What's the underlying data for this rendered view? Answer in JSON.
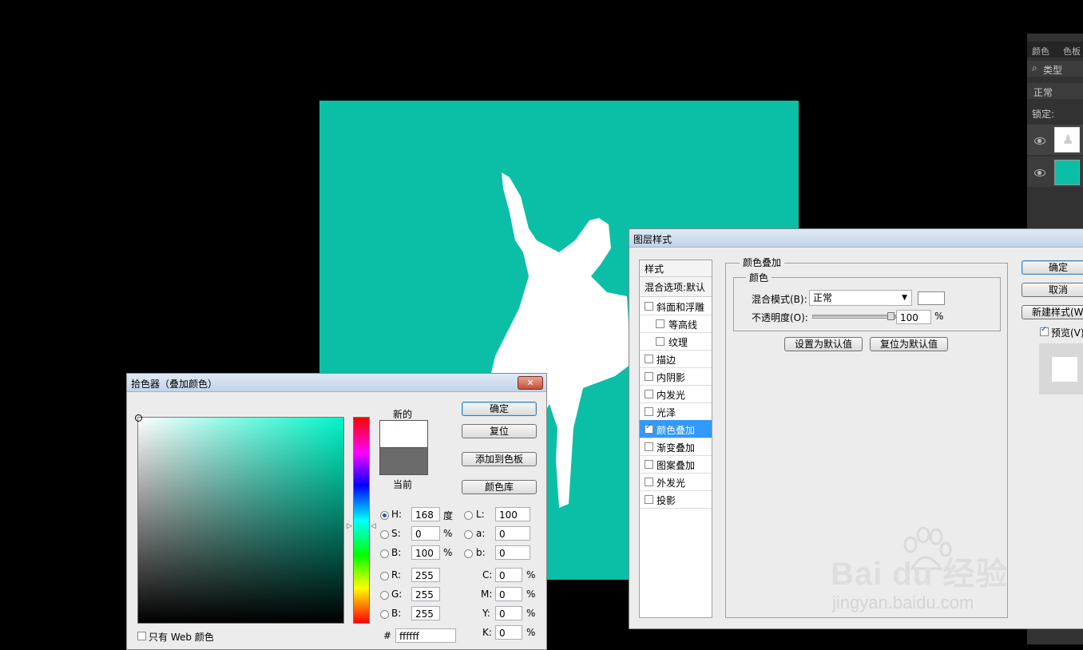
{
  "layers_panel": {
    "tabs": [
      "颜色",
      "色板"
    ],
    "filter_label": "类型",
    "blend_mode": "正常",
    "lock_label": "锁定:"
  },
  "layer_style": {
    "title": "图层样式",
    "styles_header": "样式",
    "blend_options": "混合选项:默认",
    "items": [
      {
        "label": "斜面和浮雕",
        "checked": false,
        "indent": false
      },
      {
        "label": "等高线",
        "checked": false,
        "indent": true
      },
      {
        "label": "纹理",
        "checked": false,
        "indent": true
      },
      {
        "label": "描边",
        "checked": false,
        "indent": false
      },
      {
        "label": "内阴影",
        "checked": false,
        "indent": false
      },
      {
        "label": "内发光",
        "checked": false,
        "indent": false
      },
      {
        "label": "光泽",
        "checked": false,
        "indent": false
      },
      {
        "label": "颜色叠加",
        "checked": true,
        "indent": false
      },
      {
        "label": "渐变叠加",
        "checked": false,
        "indent": false
      },
      {
        "label": "图案叠加",
        "checked": false,
        "indent": false
      },
      {
        "label": "外发光",
        "checked": false,
        "indent": false
      },
      {
        "label": "投影",
        "checked": false,
        "indent": false
      }
    ],
    "section_title": "颜色叠加",
    "sub_title": "颜色",
    "blend_mode_label": "混合模式(B):",
    "blend_mode_value": "正常",
    "opacity_label": "不透明度(O):",
    "opacity_value": "100",
    "percent": "%",
    "set_default": "设置为默认值",
    "reset_default": "复位为默认值",
    "ok": "确定",
    "cancel": "取消",
    "new_style": "新建样式(W",
    "preview": "预览(V)"
  },
  "color_picker": {
    "title": "拾色器（叠加颜色）",
    "new_label": "新的",
    "current_label": "当前",
    "ok": "确定",
    "reset": "复位",
    "add_swatch": "添加到色板",
    "color_lib": "颜色库",
    "only_web": "只有 Web 颜色",
    "hsb": [
      {
        "key": "H:",
        "value": "168",
        "unit": "度",
        "selected": true
      },
      {
        "key": "S:",
        "value": "0",
        "unit": "%",
        "selected": false
      },
      {
        "key": "B:",
        "value": "100",
        "unit": "%",
        "selected": false
      }
    ],
    "rgb": [
      {
        "key": "R:",
        "value": "255"
      },
      {
        "key": "G:",
        "value": "255"
      },
      {
        "key": "B:",
        "value": "255"
      }
    ],
    "lab": [
      {
        "key": "L:",
        "value": "100"
      },
      {
        "key": "a:",
        "value": "0"
      },
      {
        "key": "b:",
        "value": "0"
      }
    ],
    "cmyk": [
      {
        "key": "C:",
        "value": "0",
        "unit": "%"
      },
      {
        "key": "M:",
        "value": "0",
        "unit": "%"
      },
      {
        "key": "Y:",
        "value": "0",
        "unit": "%"
      },
      {
        "key": "K:",
        "value": "0",
        "unit": "%"
      }
    ],
    "hash": "#",
    "hex": "ffffff"
  },
  "watermark": {
    "brand": "Bai du 经验",
    "url": "jingyan.baidu.com"
  },
  "colors": {
    "canvas": "#0abfa6",
    "selection": "#3399ff"
  }
}
